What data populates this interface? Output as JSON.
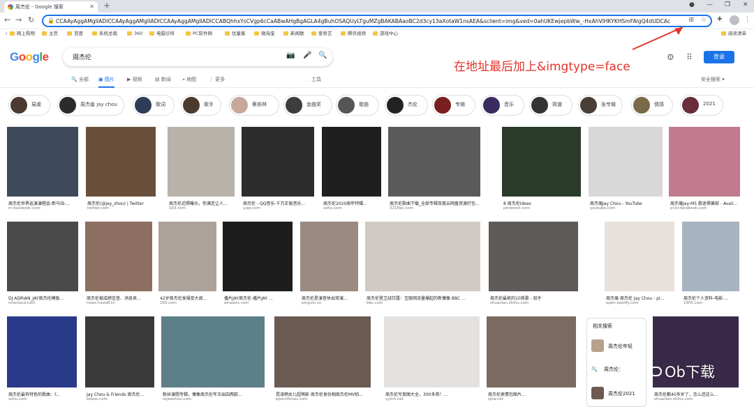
{
  "browser": {
    "tab_title": "周杰伦 - Google 搜索",
    "url": "CCAAyAggAMgIIADICCAAyAggAMgIIADICCAAyAggAMgIIADICCABQhhxYsCVgp6cCaABwAHgBgAGLA4gBuhOSAQUyLTguMZgBAKABAaoBC2d3cy13aXotaW1nsAEA&sclient=img&ved=0ahUKEwjepbWw_-HxAhVlHKYKHSmFAlgQ4dUDCAc",
    "bookmarks": [
      "网上购物",
      "主页",
      "百度",
      "系统总裁",
      "360",
      "电脑诊所",
      "PC软件网",
      "优量客",
      "微淘宝",
      "新闻联",
      "爱奇艺",
      "腾讯视频",
      "游戏中心"
    ],
    "reading_list": "阅读清单"
  },
  "google": {
    "logo_text": "Google",
    "query": "周杰伦",
    "login_label": "登录",
    "tabs": [
      "全部",
      "图片",
      "视频",
      "新闻",
      "地图",
      "更多"
    ],
    "tools_label": "工具",
    "safesearch_label": "安全搜索",
    "chips": [
      "易虞",
      "周杰倫 jay chou",
      "歌词",
      "歌手",
      "蔡依林",
      "金曲奖",
      "歌曲",
      "杰伦",
      "专辑",
      "音乐",
      "简谱",
      "张专辑",
      "情感",
      "2021"
    ]
  },
  "annotation": "在地址最后加上&imgtype=face",
  "results": [
    {
      "caption": "周杰伦世界巡演演唱会-新马站-...",
      "source": "m.facebook.com"
    },
    {
      "caption": "周杰伦(@jay_zhou) | Twitter",
      "source": "twitter.com"
    },
    {
      "caption": "周杰伦近照曝光，你满足让人...",
      "source": "163.com"
    },
    {
      "caption": "周杰伦 - QQ音乐-千万正版音乐...",
      "source": "y.qq.com"
    },
    {
      "caption": "周杰伦2020周年特辑...",
      "source": "sohu.com"
    },
    {
      "caption": "周杰伦歌曲下载_全部专辑百度云网盘资源打包...",
      "source": "321flac.com"
    },
    {
      "caption": "8 周杰伦ideas",
      "source": "pinterest.com"
    },
    {
      "caption": "周杰倫Jay Chou - YouTube",
      "source": "youtube.com"
    },
    {
      "caption": "周杰倫Jay-M5 歌迷俱樂部 - Avail...",
      "source": "pl-br.facebook.com"
    },
    {
      "caption": "DJ ADRIAN_JAY周杰伦模板...",
      "source": "mixcloud.com"
    },
    {
      "caption": "周杰伦被成绩佳音、消息来...",
      "source": "news.haveB.tv"
    },
    {
      "caption": "42岁周杰伦发福变大故...",
      "source": "163.com"
    },
    {
      "caption": "播片JAY周杰伦-播片JAY ...",
      "source": "amazon.com"
    },
    {
      "caption": "周杰伦是演音休出常演...",
      "source": "pingvin.cn"
    },
    {
      "caption": "周杰伦登卫战甘露：互联网流量爆起的新偶像 BBC ...",
      "source": "bbc.com"
    },
    {
      "caption": "周杰伦最绝的10首歌 - 知乎",
      "source": "zhuanlan.zhihu.com"
    },
    {
      "caption": "周杰倫 周杰伦 Jay Chou - pl...",
      "source": "open.spotify.com"
    },
    {
      "caption": "周杰伦个人资料-电影-...",
      "source": "1905.com"
    },
    {
      "caption": "周杰伦最有特色的歌曲：《...",
      "source": "sohu.com"
    },
    {
      "caption": "Jay Chou & Friends 周杰伦...",
      "source": "kkbox.com"
    },
    {
      "caption": "粉丝演唱专辑，偶像周杰伦年次出四两款...",
      "source": "ozjeezhuo.com"
    },
    {
      "caption": "昆凌晒女儿超萌影 周杰伦身份相周杰伦MV拍...",
      "source": "epochtimes.com"
    },
    {
      "caption": "周杰伦写真图大全，300多首！...",
      "source": "yyinh.net"
    },
    {
      "caption": "周杰伦表情包图片...",
      "source": "zjzw.net"
    },
    {
      "caption": "周杰伦都40多岁了，怎么还这么...",
      "source": "zhuanlan.zhihu.com"
    }
  ],
  "related": {
    "title": "相关搜索",
    "items": [
      "周杰伦年轻",
      "周杰伦：",
      "周杰伦2021"
    ]
  },
  "watermark": "Ob下载"
}
